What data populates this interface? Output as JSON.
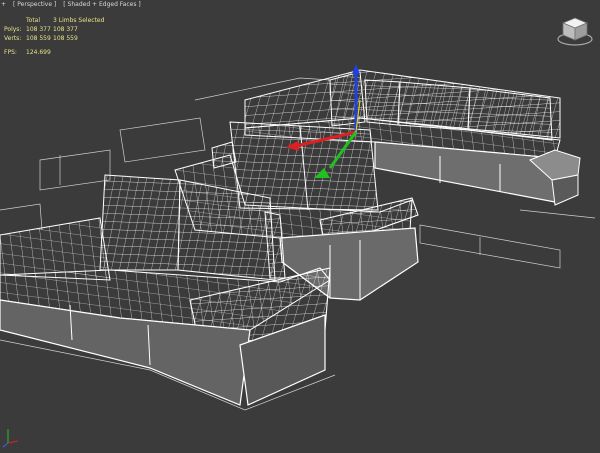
{
  "viewport": {
    "menu_plus": "+",
    "view_name": "[ Perspective ]",
    "shading_mode": "[ Shaded + Edged Faces ]"
  },
  "stats": {
    "header_total": "Total",
    "header_selection": "3 Limbs Selected",
    "polys_label": "Polys:",
    "polys_total": "108 377",
    "polys_selected": "108 377",
    "verts_label": "Verts:",
    "verts_total": "108 559",
    "verts_selected": "108 559",
    "fps_label": "FPS:",
    "fps_value": "124.699"
  },
  "colors": {
    "background": "#3b3b3b",
    "wireframe": "#ffffff",
    "stats_text": "#e8e38a",
    "gizmo_x": "#e02020",
    "gizmo_y": "#20c020",
    "gizmo_z": "#2040e0"
  },
  "icons": [
    "viewcube-icon",
    "axis-tripod-icon",
    "move-gizmo-icon"
  ]
}
